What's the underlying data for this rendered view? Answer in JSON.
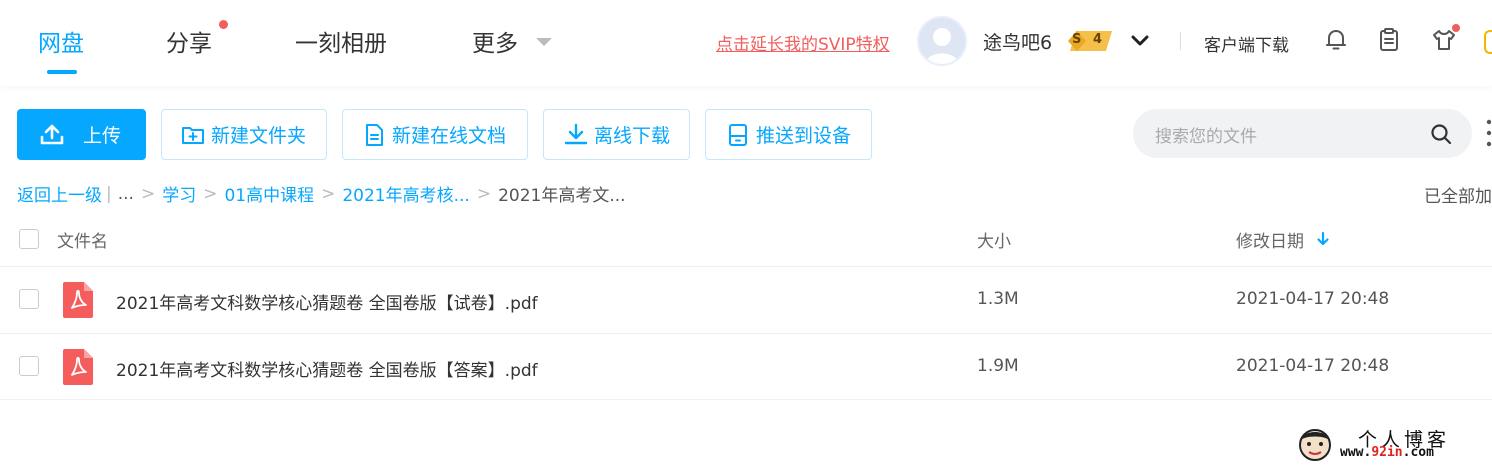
{
  "nav": {
    "items": [
      {
        "label": "网盘"
      },
      {
        "label": "分享"
      },
      {
        "label": "一刻相册"
      },
      {
        "label": "更多"
      }
    ]
  },
  "header": {
    "svip_link": "点击延长我的SVIP特权",
    "username": "途鸟吧6",
    "level_prefix": "S",
    "level": "4",
    "client_download": "客户端下载"
  },
  "toolbar": {
    "upload": "上传",
    "new_folder": "新建文件夹",
    "new_online_doc": "新建在线文档",
    "offline_download": "离线下载",
    "push_to_device": "推送到设备"
  },
  "search": {
    "placeholder": "搜索您的文件"
  },
  "breadcrumb": {
    "back": "返回上一级",
    "sep_bar": "|",
    "ellipsis": "...",
    "items": [
      "学习",
      "01高中课程",
      "2021年高考核...",
      "2021年高考文..."
    ],
    "loaded_all": "已全部加"
  },
  "table": {
    "headers": {
      "name": "文件名",
      "size": "大小",
      "modified": "修改日期"
    },
    "rows": [
      {
        "name": "2021年高考文科数学核心猜题卷 全国卷版【试卷】.pdf",
        "size": "1.3M",
        "modified": "2021-04-17 20:48"
      },
      {
        "name": "2021年高考文科数学核心猜题卷 全国卷版【答案】.pdf",
        "size": "1.9M",
        "modified": "2021-04-17 20:48"
      }
    ]
  },
  "watermark": {
    "title": "个人博客",
    "url_prefix": "www.",
    "url_mid": "92in",
    "url_suffix": ".com"
  },
  "colors": {
    "accent": "#06a7ff",
    "danger": "#f25d5d",
    "pdf": "#f55d5d",
    "badge": "#f5c04a"
  }
}
